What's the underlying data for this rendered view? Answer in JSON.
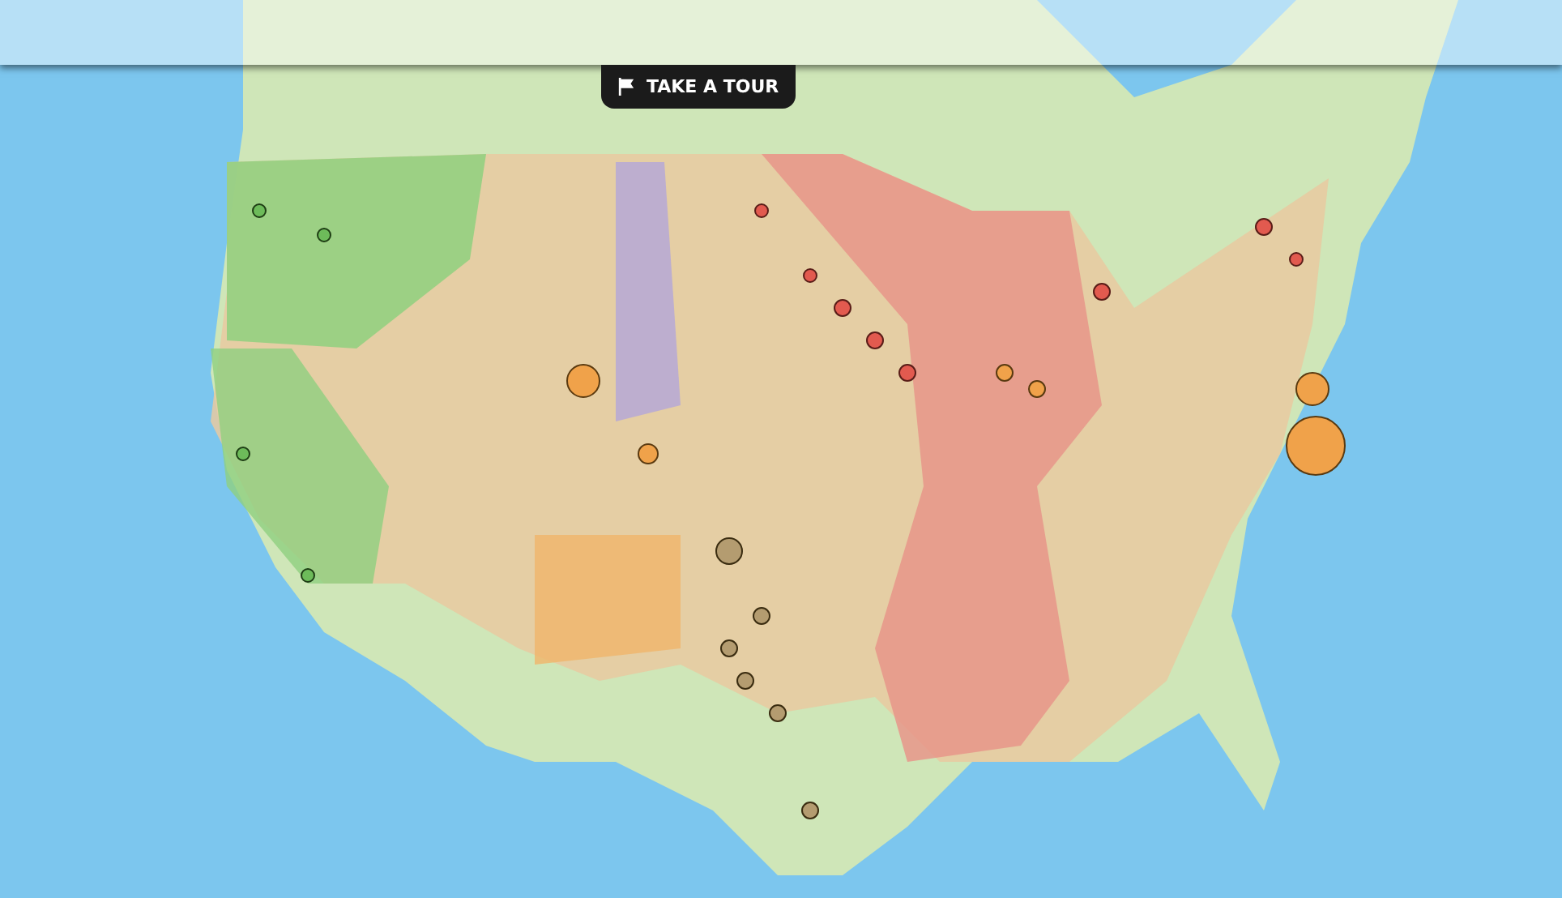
{
  "tour_button": {
    "label": "TAKE A TOUR"
  }
}
